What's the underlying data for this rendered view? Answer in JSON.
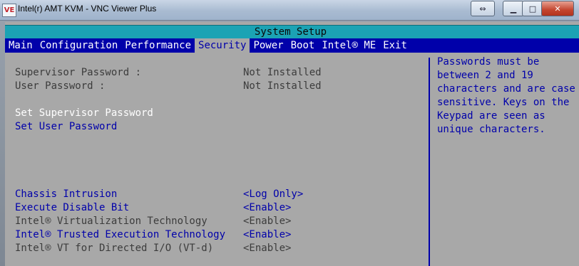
{
  "window": {
    "title": "Intel(r) AMT KVM - VNC Viewer Plus",
    "app_icon_text": "VE"
  },
  "bios": {
    "title": "System Setup",
    "tabs": [
      {
        "label": "Main",
        "active": false
      },
      {
        "label": "Configuration",
        "active": false
      },
      {
        "label": "Performance",
        "active": false
      },
      {
        "label": "Security",
        "active": true
      },
      {
        "label": "Power",
        "active": false
      },
      {
        "label": "Boot",
        "active": false
      },
      {
        "label": "Intel® ME",
        "active": false
      },
      {
        "label": "Exit",
        "active": false
      }
    ],
    "status": [
      {
        "label": "Supervisor Password :",
        "value": "Not Installed"
      },
      {
        "label": "User Password :",
        "value": "Not Installed"
      }
    ],
    "actions": [
      {
        "label": "Set Supervisor Password",
        "selected": true
      },
      {
        "label": "Set User Password",
        "selected": false
      }
    ],
    "settings": [
      {
        "label": "Chassis Intrusion",
        "value": "<Log Only>",
        "editable": true
      },
      {
        "label": "Execute Disable Bit",
        "value": "<Enable>",
        "editable": true
      },
      {
        "label": "Intel® Virtualization Technology",
        "value": "<Enable>",
        "editable": false
      },
      {
        "label": "Intel® Trusted Execution Technology",
        "value": "<Enable>",
        "editable": true
      },
      {
        "label": "Intel® VT for Directed I/O (VT-d)",
        "value": "<Enable>",
        "editable": false
      }
    ],
    "help_lines": [
      "Passwords must be",
      "between 2 and 19",
      "characters and are case",
      "sensitive. Keys on the",
      "Keypad are seen as",
      "unique characters."
    ]
  },
  "colors": {
    "bios_background": "#a8a8a8",
    "header_bar": "#1ba3b4",
    "tab_bar": "#0000aa",
    "selectable_text": "#0000aa",
    "highlight_text": "#ffffff",
    "static_text": "#3c3c3c"
  }
}
